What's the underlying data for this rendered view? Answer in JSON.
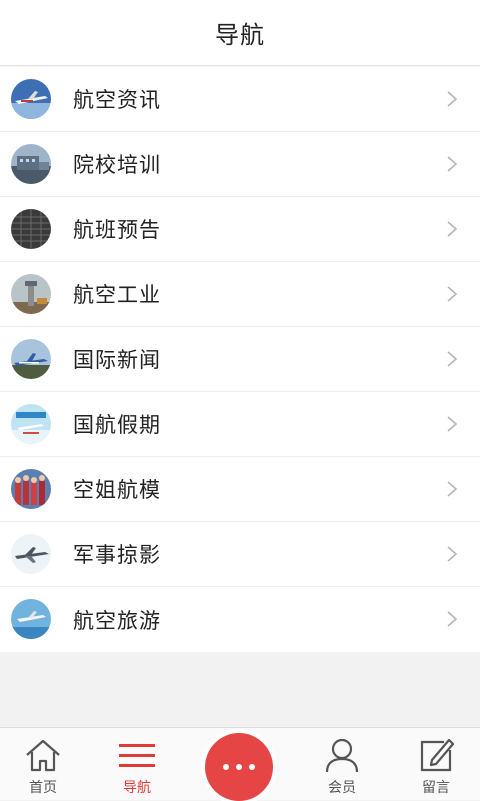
{
  "header": {
    "title": "导航"
  },
  "menu": [
    {
      "label": "航空资讯",
      "thumb": "airliner-photo"
    },
    {
      "label": "院校培训",
      "thumb": "campus-photo"
    },
    {
      "label": "航班预告",
      "thumb": "departure-board-photo"
    },
    {
      "label": "航空工业",
      "thumb": "control-tower-photo"
    },
    {
      "label": "国际新闻",
      "thumb": "jet-on-runway-photo"
    },
    {
      "label": "国航假期",
      "thumb": "holiday-banner-photo"
    },
    {
      "label": "空姐航模",
      "thumb": "flight-attendants-photo"
    },
    {
      "label": "军事掠影",
      "thumb": "military-jet-photo"
    },
    {
      "label": "航空旅游",
      "thumb": "travel-plane-photo"
    }
  ],
  "tabbar": {
    "home": "首页",
    "nav": "导航",
    "member": "会员",
    "message": "留言"
  },
  "colors": {
    "accent": "#e64545",
    "active_text": "#e03a3a"
  }
}
